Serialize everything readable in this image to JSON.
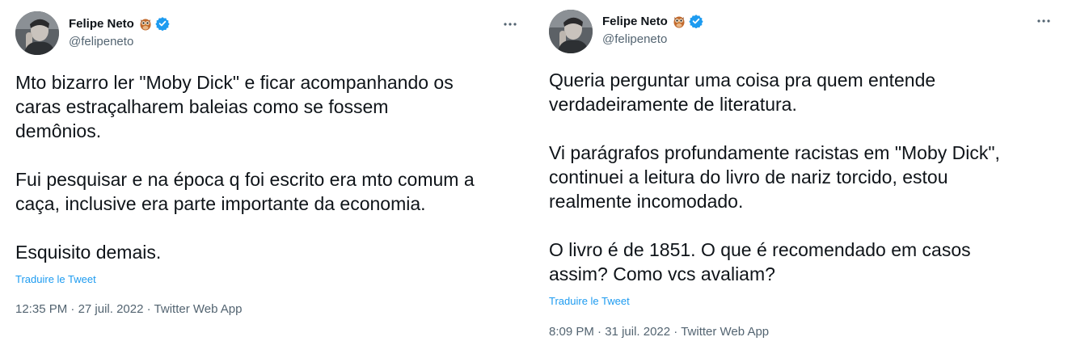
{
  "colors": {
    "text": "#0f1419",
    "secondary": "#536471",
    "link": "#1d9bf0",
    "verified": "#1d9bf0"
  },
  "tweets": [
    {
      "author": {
        "name": "Felipe Neto",
        "handle": "@felipeneto",
        "emoji_icon": "owl-icon",
        "verified_icon": "verified-badge-icon"
      },
      "more_icon": "more-options-icon",
      "paragraphs": [
        [
          "Mto bizarro ler \"Moby Dick\" e ficar acompanhando os",
          "caras estraçalharem baleias como se fossem",
          "demônios."
        ],
        [
          "Fui pesquisar e na época q foi escrito era mto comum a",
          "caça, inclusive era parte importante da economia."
        ],
        [
          "Esquisito demais."
        ]
      ],
      "translate_label": "Traduire le Tweet",
      "time": "12:35 PM",
      "date": "27 juil. 2022",
      "source": "Twitter Web App"
    },
    {
      "author": {
        "name": "Felipe Neto",
        "handle": "@felipeneto",
        "emoji_icon": "owl-icon",
        "verified_icon": "verified-badge-icon"
      },
      "more_icon": "more-options-icon",
      "paragraphs": [
        [
          "Queria perguntar uma coisa pra quem entende",
          "verdadeiramente de literatura."
        ],
        [
          "Vi parágrafos profundamente racistas em \"Moby Dick\",",
          "continuei a leitura do livro de nariz torcido, estou",
          "realmente incomodado."
        ],
        [
          "O livro é de 1851. O que é recomendado em casos",
          "assim? Como vcs avaliam?"
        ]
      ],
      "translate_label": "Traduire le Tweet",
      "time": "8:09 PM",
      "date": "31 juil. 2022",
      "source": "Twitter Web App"
    }
  ]
}
